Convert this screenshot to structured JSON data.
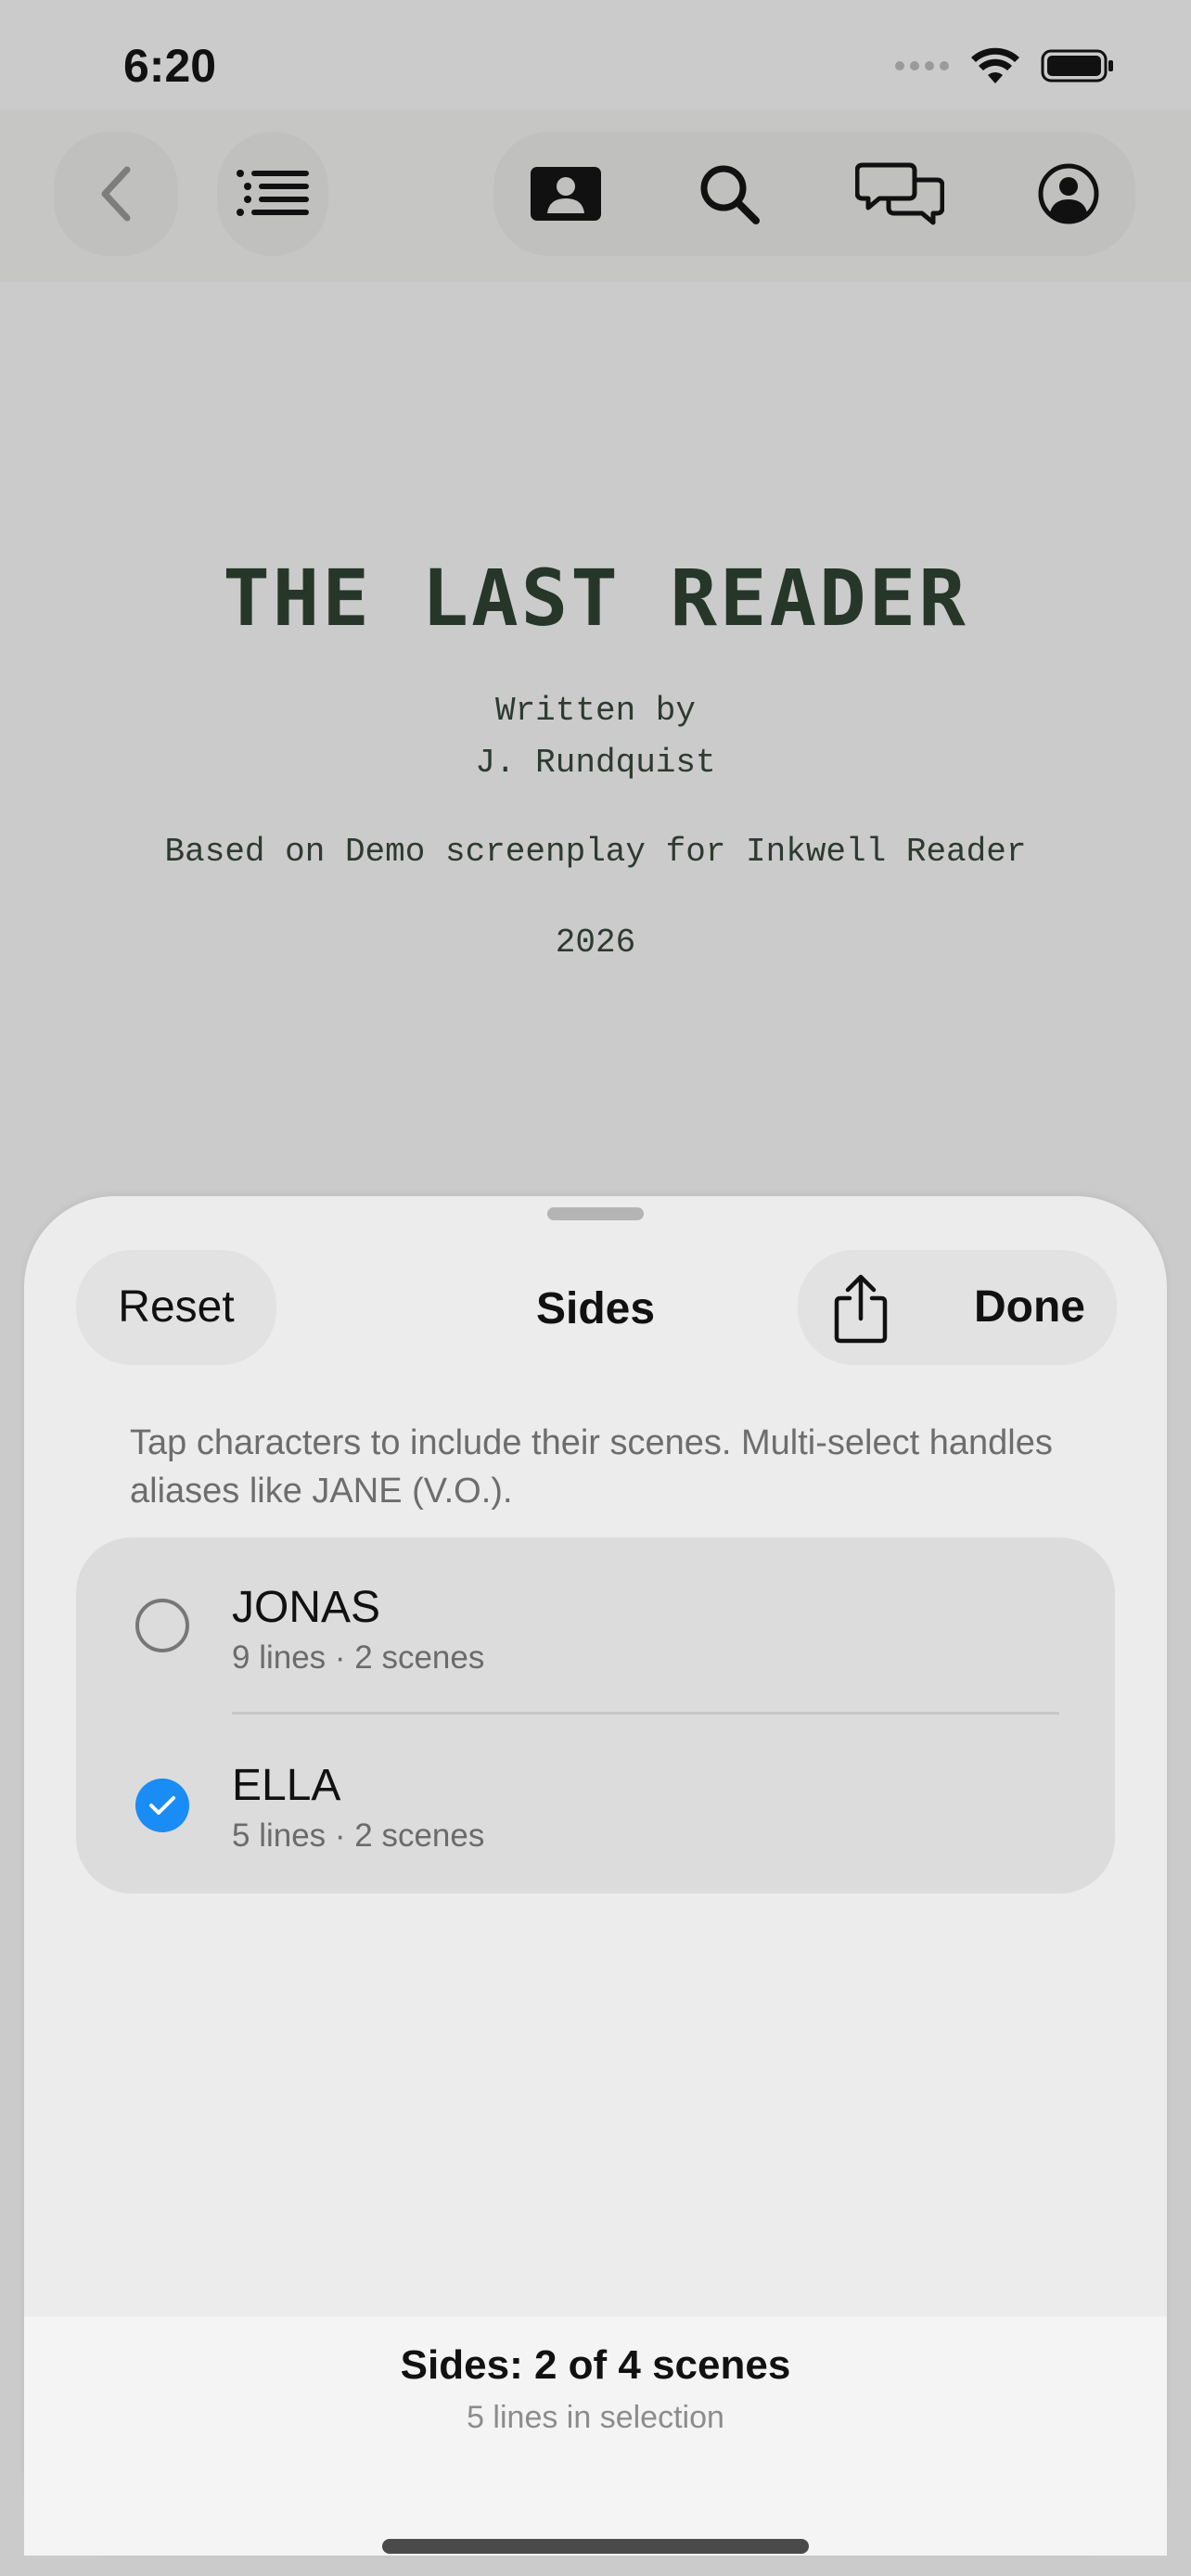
{
  "status_bar": {
    "time": "6:20"
  },
  "toolbar": {
    "icons": [
      "back-chevron-icon",
      "outline-list-icon",
      "character-card-icon",
      "search-icon",
      "comments-icon",
      "account-icon"
    ]
  },
  "title_page": {
    "title": "THE LAST READER",
    "written_by": "Written by",
    "author": "J. Rundquist",
    "based_on": "Based on Demo screenplay for Inkwell Reader",
    "year": "2026"
  },
  "sheet": {
    "reset_label": "Reset",
    "title": "Sides",
    "done_label": "Done",
    "instructions": "Tap characters to include their scenes. Multi-select handles aliases like JANE (V.O.).",
    "characters": [
      {
        "name": "JONAS",
        "meta": "9 lines · 2 scenes",
        "selected": false
      },
      {
        "name": "ELLA",
        "meta": "5 lines · 2 scenes",
        "selected": true
      }
    ],
    "summary_title": "Sides: 2 of 4 scenes",
    "summary_subtitle": "5 lines in selection"
  },
  "colors": {
    "accent_blue": "#1a8cf6",
    "title_green": "#26372a",
    "background": "#cbcbcb"
  }
}
